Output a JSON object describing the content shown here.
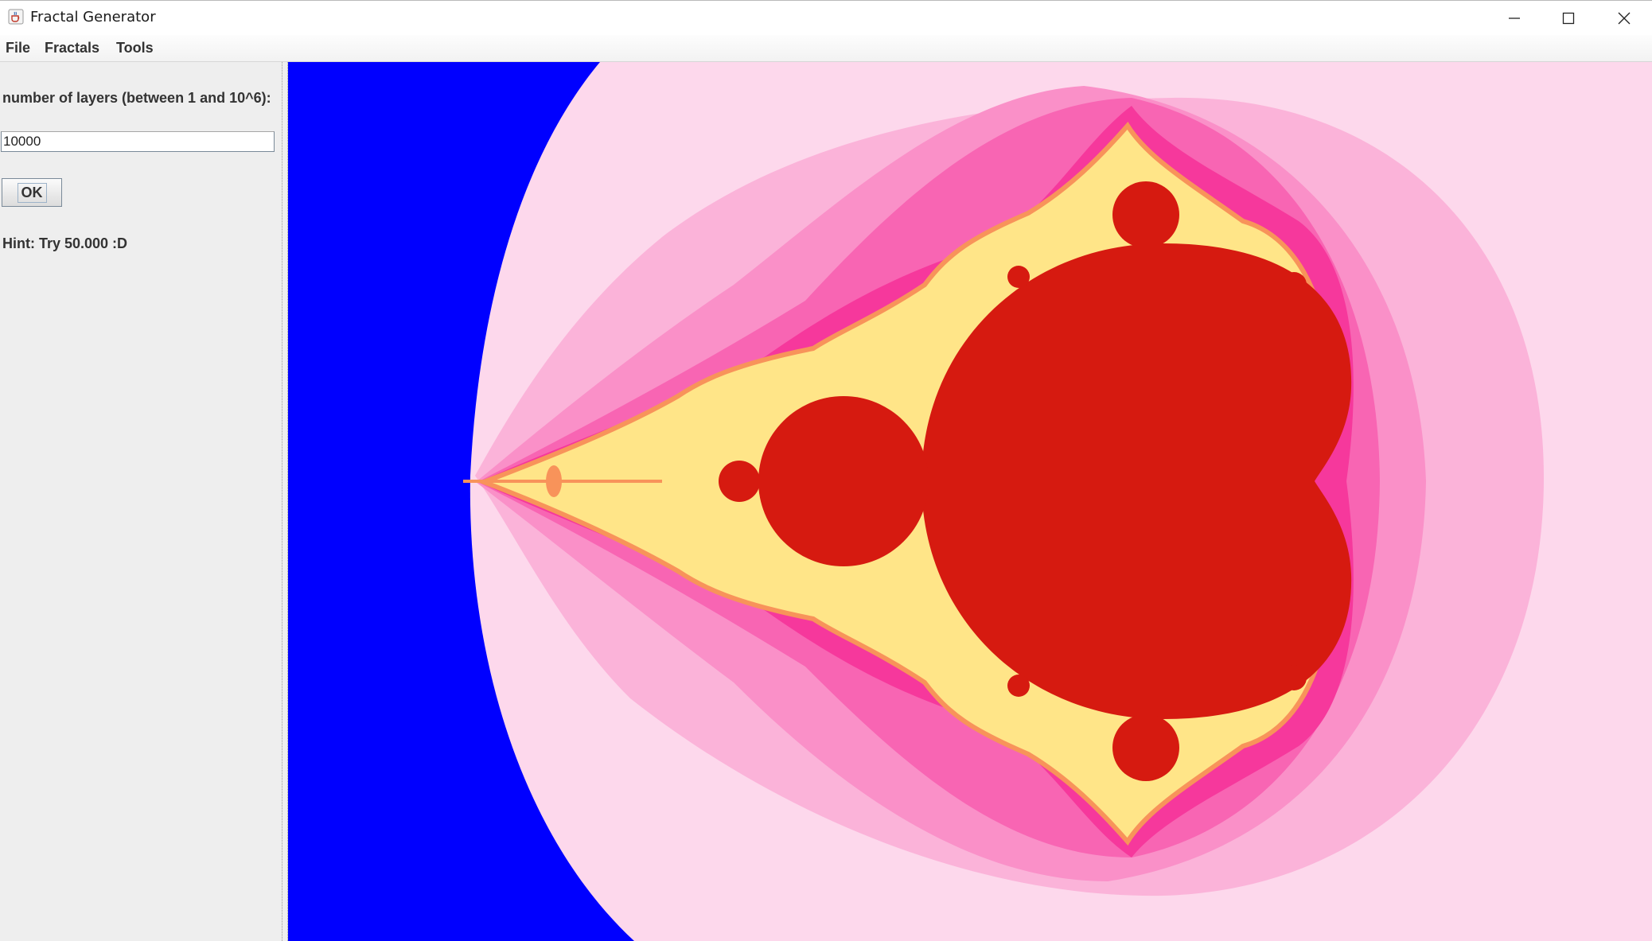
{
  "window": {
    "title": "Fractal Generator",
    "icons": {
      "app": "java-cup-icon",
      "minimize": "minimize-icon",
      "maximize": "maximize-icon",
      "close": "close-icon"
    }
  },
  "menubar": {
    "items": [
      {
        "label": "File"
      },
      {
        "label": "Fractals"
      },
      {
        "label": "Tools"
      }
    ]
  },
  "controls": {
    "layers_label": "number of layers (between 1 and 10^6):",
    "layers_value": "10000",
    "ok_label": "OK",
    "hint": "Hint: Try 50.000 :D"
  },
  "fractal": {
    "type": "Mandelbrot set",
    "colors": {
      "background": "#0000ff",
      "set_interior": "#d61a10",
      "outer_band": "#fdd8ec",
      "band_2": "#fbb3d9",
      "band_3": "#fa90c8",
      "band_4": "#f865b3",
      "band_5": "#f6389c",
      "edge_yellow": "#ffe588",
      "edge_orange": "#f8935a"
    }
  }
}
